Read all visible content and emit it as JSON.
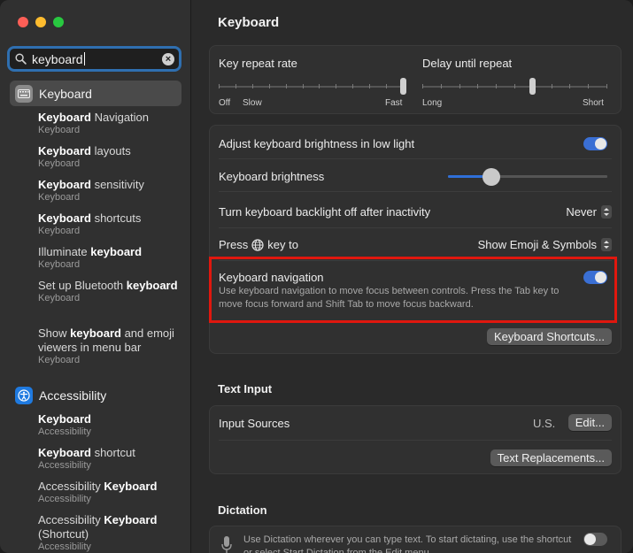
{
  "search": {
    "value": "keyboard",
    "clear_icon": "clear-icon"
  },
  "sidebar": {
    "groups": [
      {
        "header": "Keyboard",
        "icon": "keyboard-icon",
        "results": [
          {
            "title_pre": "",
            "title_bold": "Keyboard",
            "title_post": " Navigation",
            "sub": "Keyboard"
          },
          {
            "title_pre": "",
            "title_bold": "Keyboard",
            "title_post": " layouts",
            "sub": "Keyboard"
          },
          {
            "title_pre": "",
            "title_bold": "Keyboard",
            "title_post": " sensitivity",
            "sub": "Keyboard"
          },
          {
            "title_pre": "",
            "title_bold": "Keyboard",
            "title_post": " shortcuts",
            "sub": "Keyboard"
          },
          {
            "title_pre": "Illuminate ",
            "title_bold": "keyboard",
            "title_post": "",
            "sub": "Keyboard"
          },
          {
            "title_pre": "Set up Bluetooth ",
            "title_bold": "keyboard",
            "title_post": "",
            "sub": "Keyboard"
          },
          {
            "title_pre": "Show ",
            "title_bold": "keyboard",
            "title_post": " and emoji viewers in menu bar",
            "sub": "Keyboard"
          }
        ]
      },
      {
        "header": "Accessibility",
        "icon": "accessibility-icon",
        "results": [
          {
            "title_pre": "",
            "title_bold": "Keyboard",
            "title_post": "",
            "sub": "Accessibility"
          },
          {
            "title_pre": "",
            "title_bold": "Keyboard",
            "title_post": " shortcut",
            "sub": "Accessibility"
          },
          {
            "title_pre": "Accessibility ",
            "title_bold": "Keyboard",
            "title_post": "",
            "sub": "Accessibility"
          },
          {
            "title_pre": "Accessibility ",
            "title_bold": "Keyboard",
            "title_post": " (Shortcut)",
            "sub": "Accessibility"
          }
        ]
      }
    ]
  },
  "main": {
    "title": "Keyboard",
    "repeat": {
      "key_repeat_label": "Key repeat rate",
      "key_repeat_min": "Off",
      "key_repeat_slow": "Slow",
      "key_repeat_max": "Fast",
      "key_repeat_value": 1.0,
      "delay_label": "Delay until repeat",
      "delay_min": "Long",
      "delay_max": "Short",
      "delay_value": 0.6
    },
    "brightness_auto_label": "Adjust keyboard brightness in low light",
    "brightness_auto_on": true,
    "brightness_label": "Keyboard brightness",
    "brightness_value": 0.27,
    "backlight_label": "Turn keyboard backlight off after inactivity",
    "backlight_value": "Never",
    "globe_label_pre": "Press",
    "globe_label_post": "key to",
    "globe_value": "Show Emoji & Symbols",
    "nav_label": "Keyboard navigation",
    "nav_desc": "Use keyboard navigation to move focus between controls. Press the Tab key to move focus forward and Shift Tab to move focus backward.",
    "nav_on": true,
    "shortcuts_button": "Keyboard Shortcuts...",
    "text_input_title": "Text Input",
    "input_sources_label": "Input Sources",
    "input_sources_value": "U.S.",
    "edit_button": "Edit...",
    "text_replacements_button": "Text Replacements...",
    "dictation_title": "Dictation",
    "dictation_desc": "Use Dictation wherever you can type text. To start dictating, use the shortcut or select Start Dictation from the Edit menu.",
    "dictation_on": false
  }
}
